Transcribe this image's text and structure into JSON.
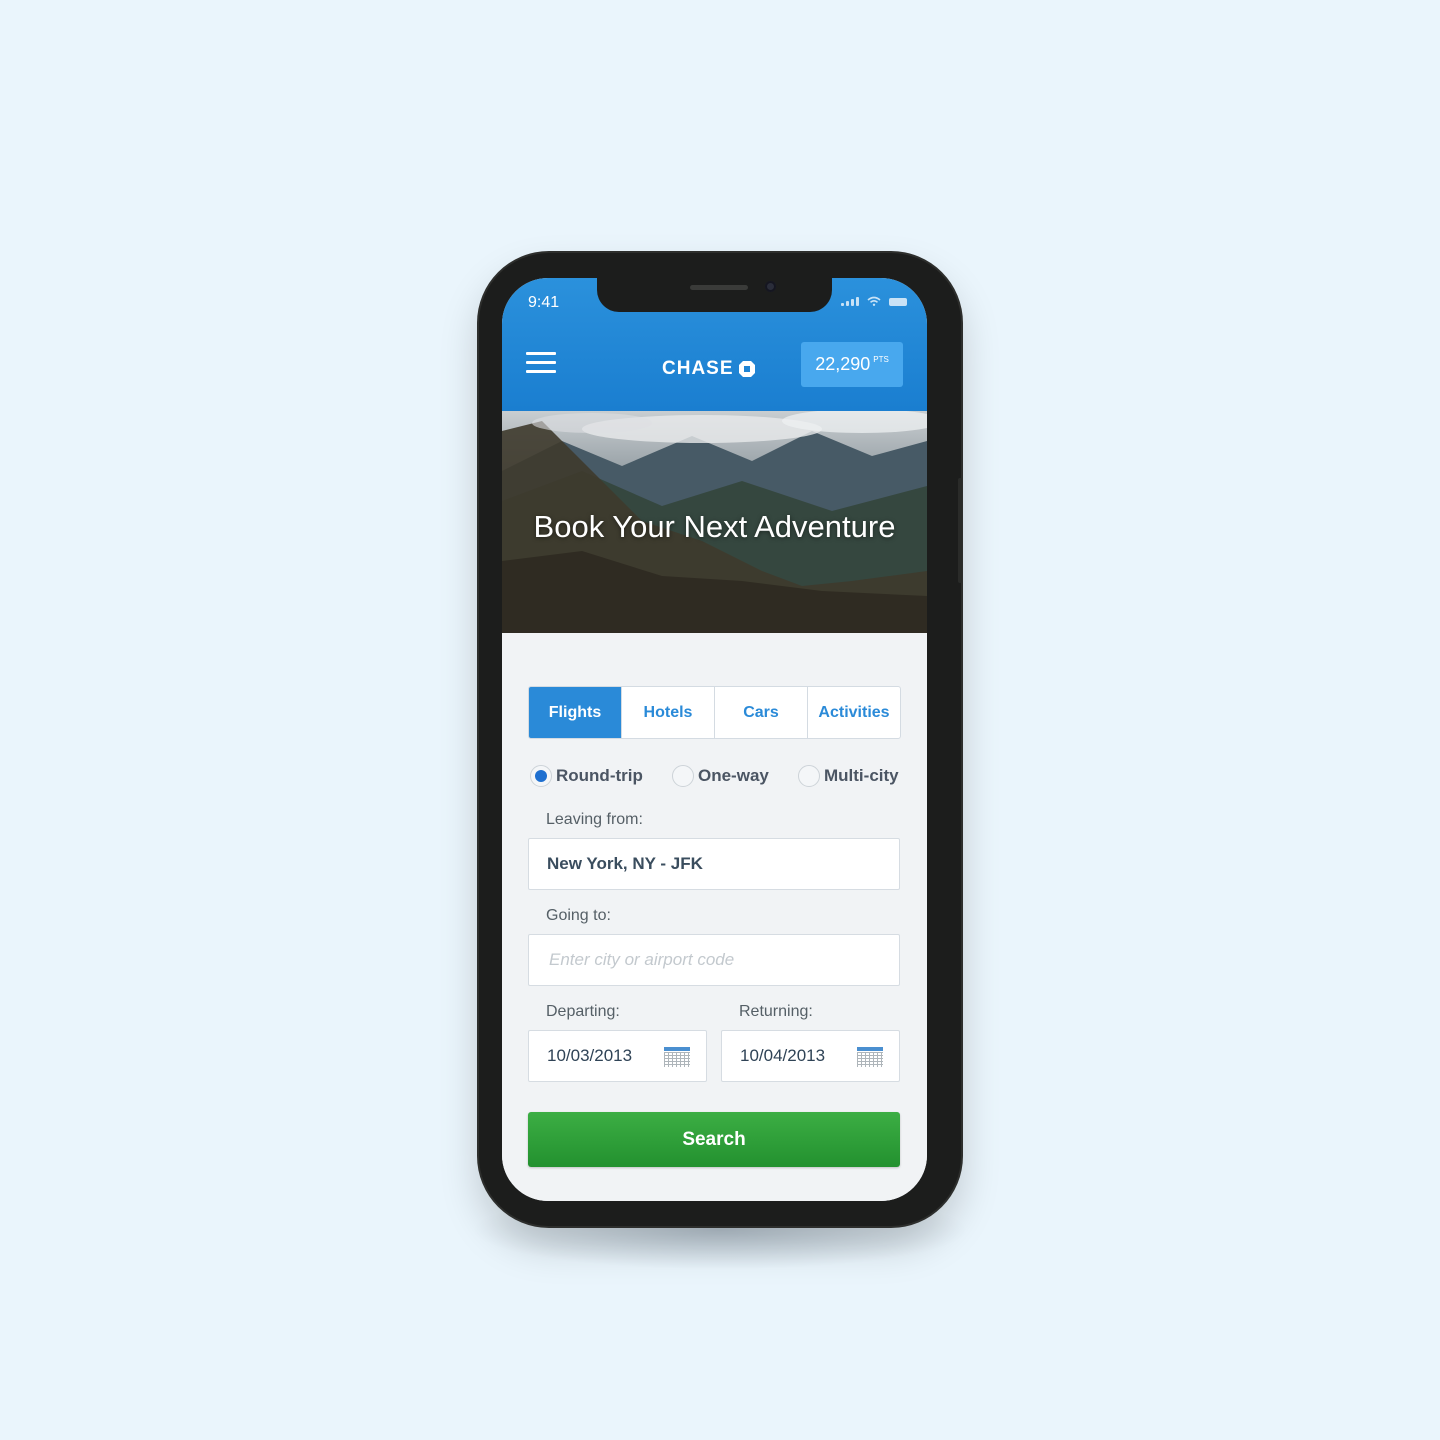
{
  "status_bar": {
    "time": "9:41"
  },
  "header": {
    "logo_text": "CHASE",
    "points_value": "22,290",
    "points_unit": "PTS"
  },
  "hero": {
    "title": "Book Your Next Adventure"
  },
  "tabs": [
    {
      "label": "Flights",
      "active": true
    },
    {
      "label": "Hotels",
      "active": false
    },
    {
      "label": "Cars",
      "active": false
    },
    {
      "label": "Activities",
      "active": false
    }
  ],
  "trip_types": [
    {
      "label": "Round-trip",
      "selected": true
    },
    {
      "label": "One-way",
      "selected": false
    },
    {
      "label": "Multi-city",
      "selected": false
    }
  ],
  "form": {
    "leaving_label": "Leaving from:",
    "leaving_value": "New York, NY - JFK",
    "going_label": "Going to:",
    "going_placeholder": "Enter city or airport code",
    "departing_label": "Departing:",
    "departing_value": "10/03/2013",
    "returning_label": "Returning:",
    "returning_value": "10/04/2013",
    "search_label": "Search"
  },
  "colors": {
    "brand_blue": "#1a7ed0",
    "search_green": "#2fa23a",
    "background": "#eaf5fc"
  }
}
